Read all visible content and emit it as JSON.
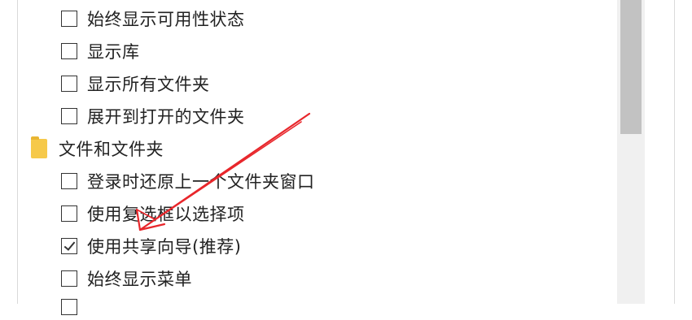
{
  "options_top": [
    {
      "label": "始终显示可用性状态",
      "checked": false
    },
    {
      "label": "显示库",
      "checked": false
    },
    {
      "label": "显示所有文件夹",
      "checked": false
    },
    {
      "label": "展开到打开的文件夹",
      "checked": false
    }
  ],
  "folder_group": {
    "label": "文件和文件夹",
    "icon": "folder-icon"
  },
  "options_folder": [
    {
      "label": "登录时还原上一个文件夹窗口",
      "checked": false
    },
    {
      "label": "使用复选框以选择项",
      "checked": false
    },
    {
      "label": "使用共享向导(推荐)",
      "checked": true
    },
    {
      "label": "始终显示菜单",
      "checked": false
    }
  ],
  "annotation": {
    "color": "#e8262b",
    "type": "red-arrow"
  }
}
